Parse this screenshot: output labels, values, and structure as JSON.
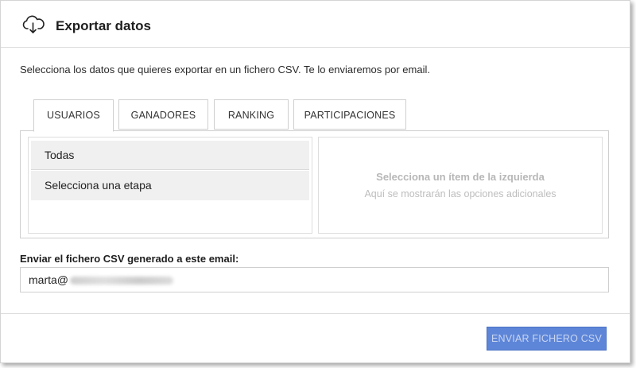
{
  "header": {
    "icon": "cloud-download-icon",
    "title": "Exportar datos"
  },
  "intro": "Selecciona los datos que quieres exportar en un fichero CSV. Te lo enviaremos por email.",
  "tabs": [
    {
      "label": "USUARIOS",
      "active": true
    },
    {
      "label": "GANADORES",
      "active": false
    },
    {
      "label": "RANKING",
      "active": false
    },
    {
      "label": "PARTICIPACIONES",
      "active": false
    }
  ],
  "left_list": {
    "items": [
      "Todas",
      "Selecciona una etapa"
    ]
  },
  "right_panel": {
    "title": "Selecciona un ítem de la izquierda",
    "subtitle": "Aquí se mostrarán las opciones adicionales"
  },
  "email": {
    "label": "Enviar el fichero CSV generado a este email:",
    "value_visible": "marta@"
  },
  "footer": {
    "send_label": "ENVIAR FICHERO CSV"
  },
  "colors": {
    "button_bg": "#5e86d8",
    "button_text": "#c9d6f2"
  }
}
